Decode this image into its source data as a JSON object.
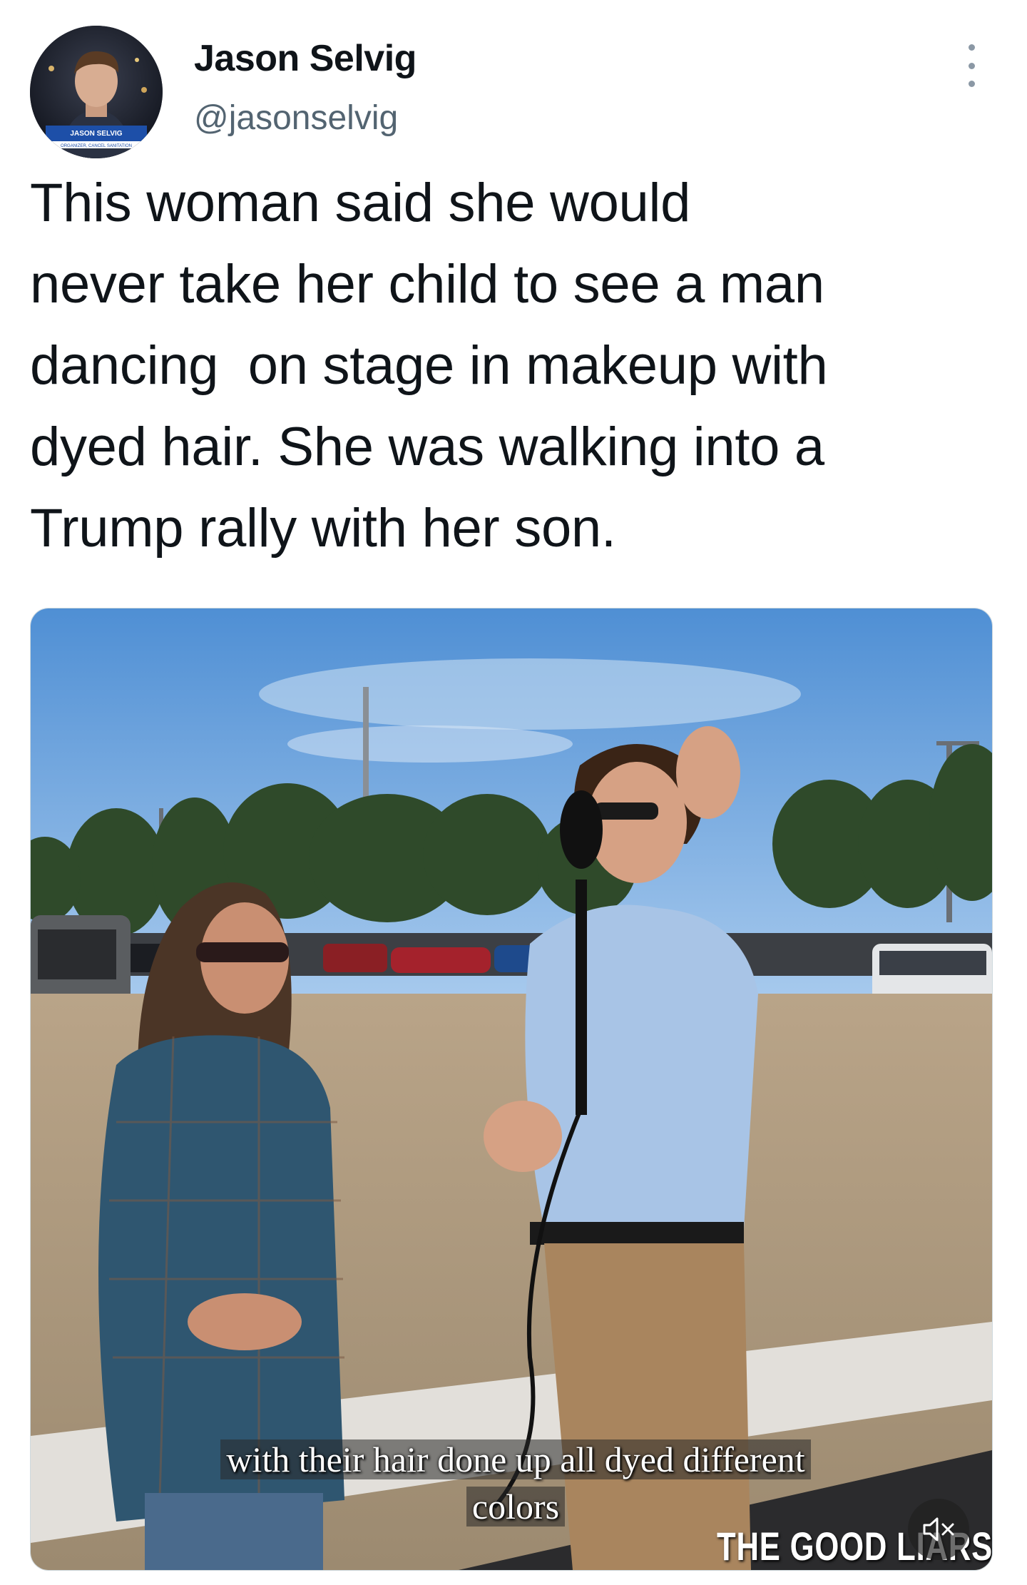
{
  "author": {
    "name": "Jason Selvig",
    "handle": "@jasonselvig",
    "avatar_caption": "JASON SELVIG",
    "avatar_subcaption": "ORGANIZER, CANCEL SANITATION"
  },
  "tweet": {
    "text": "This woman said she would\nnever take her child to see a man\ndancing  on stage in makeup with\ndyed hair. She was walking into a\nTrump rally with her son."
  },
  "media": {
    "caption_line1": "with their hair done up all dyed different",
    "caption_line2": "colors",
    "watermark": "THE GOOD LIARS",
    "mute_icon": "speaker-muted-icon"
  },
  "colors": {
    "text": "#0f1419",
    "secondary_text": "#536471",
    "sky": "#6ea6dd"
  }
}
